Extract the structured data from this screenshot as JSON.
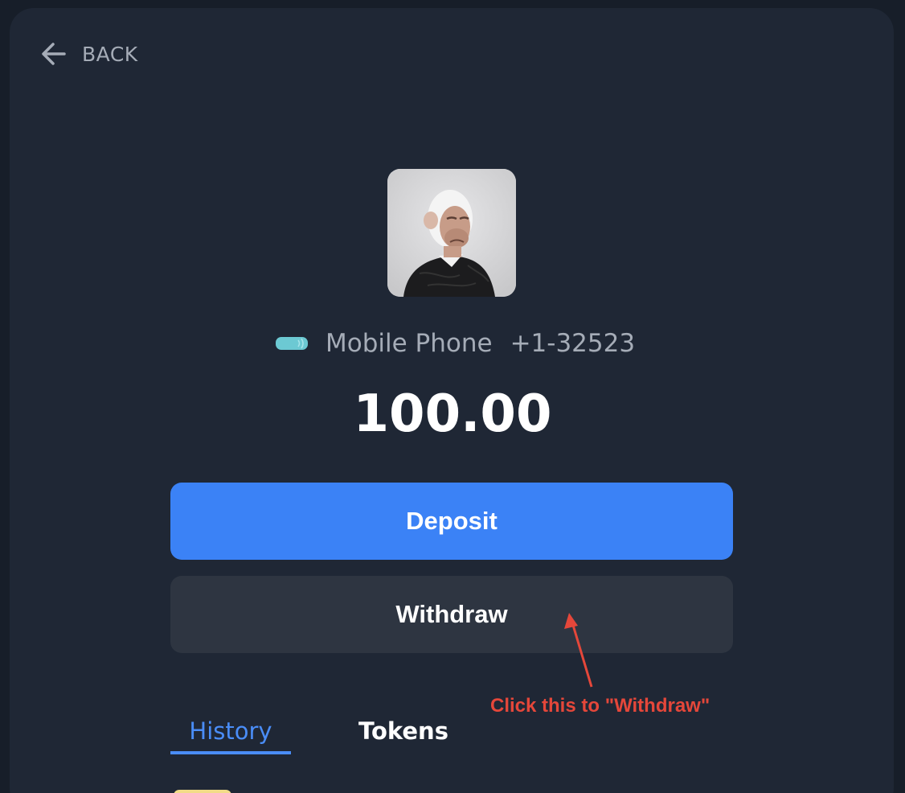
{
  "nav": {
    "back_label": "BACK"
  },
  "account": {
    "method": "Mobile Phone",
    "number": "+1-32523",
    "balance": "100.00"
  },
  "actions": {
    "deposit_label": "Deposit",
    "withdraw_label": "Withdraw"
  },
  "annotation": {
    "text": "Click this to \"Withdraw\"",
    "color": "#e5473a"
  },
  "tabs": [
    {
      "label": "History",
      "active": true
    },
    {
      "label": "Tokens",
      "active": false
    }
  ],
  "colors": {
    "background": "#171e29",
    "panel": "#1f2735",
    "accent": "#3b82f6",
    "secondary_button": "#2e3541",
    "muted_text": "#a5acb7"
  },
  "icons": {
    "back": "arrow-left-icon",
    "phone": "mobile-phone-icon",
    "avatar": "ape-avatar"
  }
}
